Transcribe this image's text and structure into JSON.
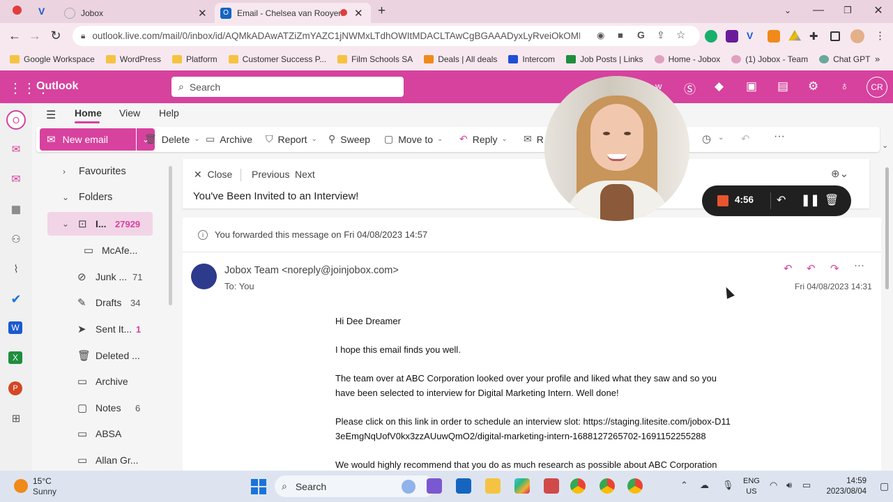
{
  "browser": {
    "tabs": [
      {
        "title": "Jobox"
      },
      {
        "title": "Email - Chelsea van Rooyen"
      }
    ],
    "url": "outlook.live.com/mail/0/inbox/id/AQMkADAwATZiZmYAZC1jNWMxLTdhOWItMDACLTAwCgBGAAADyxLyRveiOkOMMT6j...",
    "bookmarks": [
      "Google Workspace",
      "WordPress",
      "Platform",
      "Customer Success P...",
      "Film Schools SA",
      "Deals | All deals",
      "Intercom",
      "Job Posts | Links",
      "Home - Jobox",
      "(1) Jobox - Team",
      "Chat GPT"
    ]
  },
  "outlook": {
    "brand": "Outlook",
    "search_placeholder": "Search",
    "header_partial_label": "w",
    "user_initials": "CR",
    "ribbon_tabs": [
      "Home",
      "View",
      "Help"
    ],
    "toolbar": {
      "new_email": "New email",
      "delete": "Delete",
      "archive": "Archive",
      "report": "Report",
      "sweep": "Sweep",
      "move_to": "Move to",
      "reply": "Reply",
      "read_partial": "R"
    },
    "folders": {
      "favourites": "Favourites",
      "folders": "Folders",
      "items": [
        {
          "name": "I...",
          "count": "27929"
        },
        {
          "name": "McAfe...",
          "count": ""
        },
        {
          "name": "Junk ...",
          "count": "71"
        },
        {
          "name": "Drafts",
          "count": "34"
        },
        {
          "name": "Sent It...",
          "count": "1"
        },
        {
          "name": "Deleted ...",
          "count": ""
        },
        {
          "name": "Archive",
          "count": ""
        },
        {
          "name": "Notes",
          "count": "6"
        },
        {
          "name": "ABSA",
          "count": ""
        },
        {
          "name": "Allan Gr...",
          "count": ""
        }
      ]
    },
    "message": {
      "close": "Close",
      "previous": "Previous",
      "next": "Next",
      "subject": "You've Been Invited to an Interview!",
      "forward_notice": "You forwarded this message on Fri 04/08/2023 14:57",
      "sender": "Jobox Team <noreply@joinjobox.com>",
      "to": "To:  You",
      "date": "Fri 04/08/2023 14:31",
      "body": [
        "Hi Dee Dreamer",
        "I hope this email finds you well.",
        "The team over at ABC Corporation looked over your profile and liked what they saw and so you have been selected to interview for Digital Marketing Intern. Well done!",
        "Please click on this link in order to schedule an interview slot: https://staging.litesite.com/jobox-D113eEmgNqUofV0kx3zzAUuwQmO2/digital-marketing-intern-1688127265702-1691152255288",
        "We would highly recommend that you do as much research as possible about ABC Corporation"
      ]
    }
  },
  "recorder": {
    "time": "4:56"
  },
  "taskbar": {
    "temperature": "15°C",
    "weather": "Sunny",
    "search": "Search",
    "lang_1": "ENG",
    "lang_2": "US",
    "time": "14:59",
    "date": "2023/08/04"
  },
  "colors": {
    "accent": "#d6429e",
    "tab_strip": "#ebd3e0",
    "sender_avatar": "#2e3a8c",
    "recorder": "#202020"
  }
}
